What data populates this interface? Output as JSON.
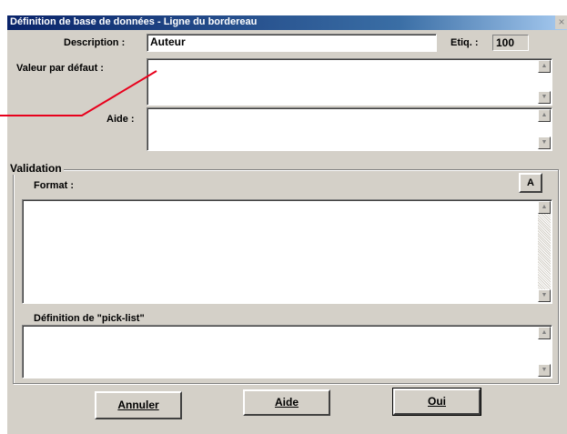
{
  "window": {
    "title": "Définition de base de données - Ligne du bordereau",
    "close_glyph": "×"
  },
  "fields": {
    "description_label": "Description :",
    "description_value": "Auteur",
    "tag_label": "Etiq. :",
    "tag_value": "100",
    "default_label": "Valeur par défaut :",
    "help_label": "Aide :"
  },
  "validation": {
    "group_label": "Validation",
    "format_label": "Format :",
    "font_button_glyph": "A",
    "picklist_label": "Définition de \"pick-list\""
  },
  "buttons": {
    "cancel": "Annuler",
    "help": "Aide",
    "ok": "Oui"
  },
  "scroll": {
    "up": "▲",
    "down": "▼"
  },
  "annotation": {
    "color": "#e8001c"
  }
}
